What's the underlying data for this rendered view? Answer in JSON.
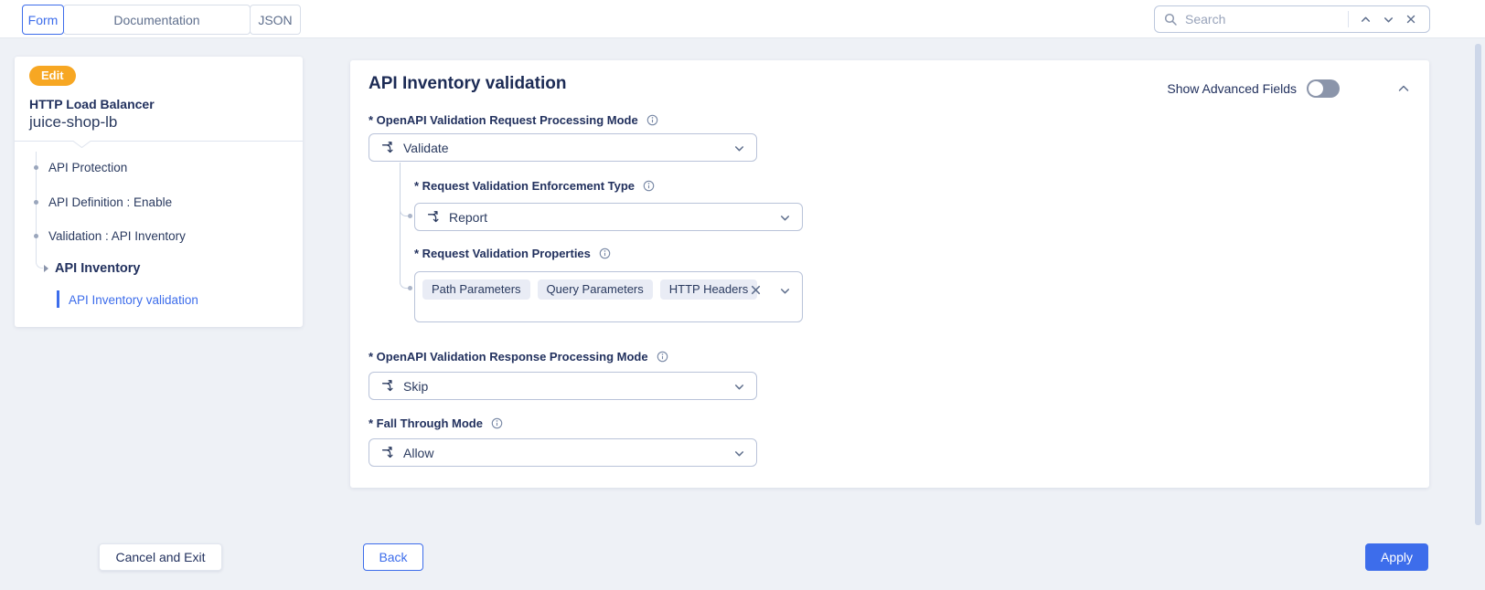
{
  "topbar": {
    "tabs": [
      {
        "label": "Form",
        "active": true
      },
      {
        "label": "Documentation",
        "active": false
      },
      {
        "label": "JSON",
        "active": false
      }
    ],
    "search": {
      "placeholder": "Search"
    }
  },
  "sidebar": {
    "badge": "Edit",
    "object_type": "HTTP Load Balancer",
    "object_name": "juice-shop-lb",
    "items": [
      {
        "label": "API Protection"
      },
      {
        "label": "API Definition : Enable"
      },
      {
        "label": "Validation : API Inventory"
      },
      {
        "label": "API Inventory"
      },
      {
        "label": "API Inventory validation",
        "selected": true
      }
    ]
  },
  "main": {
    "title": "API Inventory validation",
    "advanced_toggle_label": "Show Advanced Fields",
    "advanced_toggle_on": false,
    "fields": {
      "request_mode": {
        "label": "* OpenAPI Validation Request Processing Mode",
        "value": "Validate"
      },
      "enforcement_type": {
        "label": "* Request Validation Enforcement Type",
        "value": "Report"
      },
      "properties": {
        "label": "* Request Validation Properties",
        "tags": [
          "Path Parameters",
          "Query Parameters",
          "HTTP Headers"
        ]
      },
      "response_mode": {
        "label": "* OpenAPI Validation Response Processing Mode",
        "value": "Skip"
      },
      "fall_through_mode": {
        "label": "* Fall Through Mode",
        "value": "Allow"
      }
    }
  },
  "footer": {
    "cancel": "Cancel and Exit",
    "back": "Back",
    "apply": "Apply"
  },
  "colors": {
    "accent_blue": "#3d6deb",
    "badge_orange": "#f7a723",
    "text_navy": "#22315e"
  }
}
